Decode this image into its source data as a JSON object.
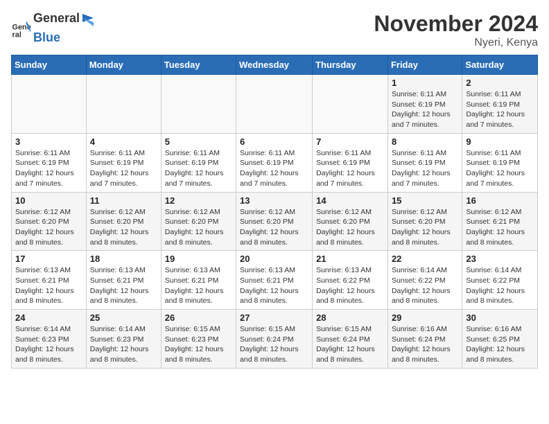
{
  "logo": {
    "text_general": "General",
    "text_blue": "Blue"
  },
  "title": "November 2024",
  "location": "Nyeri, Kenya",
  "days_of_week": [
    "Sunday",
    "Monday",
    "Tuesday",
    "Wednesday",
    "Thursday",
    "Friday",
    "Saturday"
  ],
  "weeks": [
    [
      {
        "day": "",
        "info": ""
      },
      {
        "day": "",
        "info": ""
      },
      {
        "day": "",
        "info": ""
      },
      {
        "day": "",
        "info": ""
      },
      {
        "day": "",
        "info": ""
      },
      {
        "day": "1",
        "info": "Sunrise: 6:11 AM\nSunset: 6:19 PM\nDaylight: 12 hours and 7 minutes."
      },
      {
        "day": "2",
        "info": "Sunrise: 6:11 AM\nSunset: 6:19 PM\nDaylight: 12 hours and 7 minutes."
      }
    ],
    [
      {
        "day": "3",
        "info": "Sunrise: 6:11 AM\nSunset: 6:19 PM\nDaylight: 12 hours and 7 minutes."
      },
      {
        "day": "4",
        "info": "Sunrise: 6:11 AM\nSunset: 6:19 PM\nDaylight: 12 hours and 7 minutes."
      },
      {
        "day": "5",
        "info": "Sunrise: 6:11 AM\nSunset: 6:19 PM\nDaylight: 12 hours and 7 minutes."
      },
      {
        "day": "6",
        "info": "Sunrise: 6:11 AM\nSunset: 6:19 PM\nDaylight: 12 hours and 7 minutes."
      },
      {
        "day": "7",
        "info": "Sunrise: 6:11 AM\nSunset: 6:19 PM\nDaylight: 12 hours and 7 minutes."
      },
      {
        "day": "8",
        "info": "Sunrise: 6:11 AM\nSunset: 6:19 PM\nDaylight: 12 hours and 7 minutes."
      },
      {
        "day": "9",
        "info": "Sunrise: 6:11 AM\nSunset: 6:19 PM\nDaylight: 12 hours and 7 minutes."
      }
    ],
    [
      {
        "day": "10",
        "info": "Sunrise: 6:12 AM\nSunset: 6:20 PM\nDaylight: 12 hours and 8 minutes."
      },
      {
        "day": "11",
        "info": "Sunrise: 6:12 AM\nSunset: 6:20 PM\nDaylight: 12 hours and 8 minutes."
      },
      {
        "day": "12",
        "info": "Sunrise: 6:12 AM\nSunset: 6:20 PM\nDaylight: 12 hours and 8 minutes."
      },
      {
        "day": "13",
        "info": "Sunrise: 6:12 AM\nSunset: 6:20 PM\nDaylight: 12 hours and 8 minutes."
      },
      {
        "day": "14",
        "info": "Sunrise: 6:12 AM\nSunset: 6:20 PM\nDaylight: 12 hours and 8 minutes."
      },
      {
        "day": "15",
        "info": "Sunrise: 6:12 AM\nSunset: 6:20 PM\nDaylight: 12 hours and 8 minutes."
      },
      {
        "day": "16",
        "info": "Sunrise: 6:12 AM\nSunset: 6:21 PM\nDaylight: 12 hours and 8 minutes."
      }
    ],
    [
      {
        "day": "17",
        "info": "Sunrise: 6:13 AM\nSunset: 6:21 PM\nDaylight: 12 hours and 8 minutes."
      },
      {
        "day": "18",
        "info": "Sunrise: 6:13 AM\nSunset: 6:21 PM\nDaylight: 12 hours and 8 minutes."
      },
      {
        "day": "19",
        "info": "Sunrise: 6:13 AM\nSunset: 6:21 PM\nDaylight: 12 hours and 8 minutes."
      },
      {
        "day": "20",
        "info": "Sunrise: 6:13 AM\nSunset: 6:21 PM\nDaylight: 12 hours and 8 minutes."
      },
      {
        "day": "21",
        "info": "Sunrise: 6:13 AM\nSunset: 6:22 PM\nDaylight: 12 hours and 8 minutes."
      },
      {
        "day": "22",
        "info": "Sunrise: 6:14 AM\nSunset: 6:22 PM\nDaylight: 12 hours and 8 minutes."
      },
      {
        "day": "23",
        "info": "Sunrise: 6:14 AM\nSunset: 6:22 PM\nDaylight: 12 hours and 8 minutes."
      }
    ],
    [
      {
        "day": "24",
        "info": "Sunrise: 6:14 AM\nSunset: 6:23 PM\nDaylight: 12 hours and 8 minutes."
      },
      {
        "day": "25",
        "info": "Sunrise: 6:14 AM\nSunset: 6:23 PM\nDaylight: 12 hours and 8 minutes."
      },
      {
        "day": "26",
        "info": "Sunrise: 6:15 AM\nSunset: 6:23 PM\nDaylight: 12 hours and 8 minutes."
      },
      {
        "day": "27",
        "info": "Sunrise: 6:15 AM\nSunset: 6:24 PM\nDaylight: 12 hours and 8 minutes."
      },
      {
        "day": "28",
        "info": "Sunrise: 6:15 AM\nSunset: 6:24 PM\nDaylight: 12 hours and 8 minutes."
      },
      {
        "day": "29",
        "info": "Sunrise: 6:16 AM\nSunset: 6:24 PM\nDaylight: 12 hours and 8 minutes."
      },
      {
        "day": "30",
        "info": "Sunrise: 6:16 AM\nSunset: 6:25 PM\nDaylight: 12 hours and 8 minutes."
      }
    ]
  ]
}
